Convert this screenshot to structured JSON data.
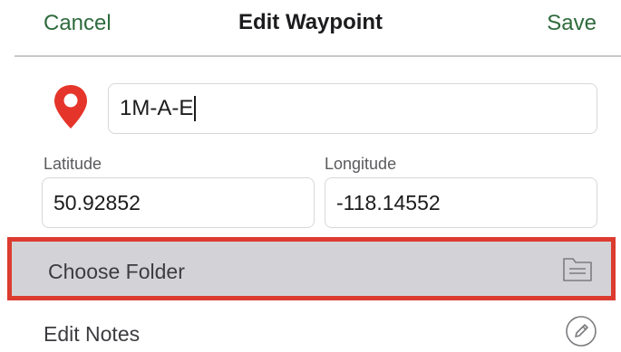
{
  "nav": {
    "cancel_label": "Cancel",
    "title": "Edit Waypoint",
    "save_label": "Save"
  },
  "waypoint": {
    "name": "1M-A-E",
    "marker_icon": "map-pin-icon",
    "marker_color": "#e5352b"
  },
  "coordinates": {
    "latitude_label": "Latitude",
    "latitude_value": "50.92852",
    "longitude_label": "Longitude",
    "longitude_value": "-118.14552"
  },
  "rows": {
    "folder_label": "Choose Folder",
    "folder_icon": "folder-icon",
    "notes_label": "Edit Notes",
    "notes_icon": "pencil-icon"
  },
  "colors": {
    "accent": "#2e6b3d",
    "highlight_border": "#dc3b30",
    "selected_row_bg": "#d3d3d7"
  }
}
